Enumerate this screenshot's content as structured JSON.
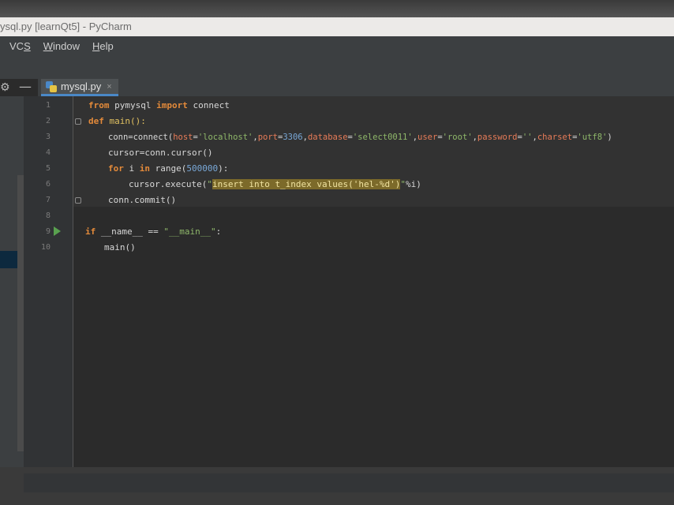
{
  "window": {
    "title": "ysql.py [learnQt5] - PyCharm"
  },
  "menu": [
    {
      "pre": "VC",
      "mn": "S",
      "post": ""
    },
    {
      "pre": "",
      "mn": "W",
      "post": "indow"
    },
    {
      "pre": "",
      "mn": "H",
      "post": "elp"
    }
  ],
  "tab": {
    "label": "mysql.py",
    "close": "×"
  },
  "icons": [
    "gear-icon",
    "minus-icon",
    "python-file-icon",
    "close-icon",
    "run-icon",
    "fold-icon"
  ],
  "colors": {
    "keyword": "#e38a3a",
    "string": "#8fb86a",
    "number": "#79a8d8",
    "param": "#e87c58",
    "highlight": "#7c6a2a"
  },
  "line_numbers": [
    "1",
    "2",
    "3",
    "4",
    "5",
    "6",
    "7",
    "8",
    "9",
    "10"
  ],
  "code": {
    "l1": {
      "kw1": "from",
      "mid": " pymysql ",
      "kw2": "import",
      "tail": " connect"
    },
    "l2": {
      "kw": "def",
      "name": "main():"
    },
    "l3": {
      "a": "conn=connect(",
      "p1": "host",
      "eq1": "=",
      "s1": "'localhost'",
      "c1": ",",
      "p2": "port",
      "eq2": "=",
      "n2": "3306",
      "c2": ",",
      "p3": "database",
      "eq3": "=",
      "s3": "'select0011'",
      "c3": ",",
      "p4": "user",
      "eq4": "=",
      "s4": "'root'",
      "c4": ",",
      "p5": "password",
      "eq5": "=",
      "s5": "''",
      "c5": ",",
      "p6": "charset",
      "eq6": "=",
      "s6": "'utf8'",
      "z": ")"
    },
    "l4": {
      "text": "cursor=conn.cursor()"
    },
    "l5": {
      "kw1": "for",
      "mid": " i ",
      "kw2": "in",
      "a": " range(",
      "n": "500000",
      "b": "):"
    },
    "l6": {
      "a": "cursor.execute(",
      "q": "\"",
      "hl": "insert into t_index values('hel-%d')",
      "q2": "\"",
      "tail": "%i)"
    },
    "l7": {
      "text": "conn.commit()"
    },
    "l9": {
      "kw": "if",
      "a": " __name__ == ",
      "s": "\"__main__\"",
      "b": ":"
    },
    "l10": {
      "text": "main()"
    }
  }
}
